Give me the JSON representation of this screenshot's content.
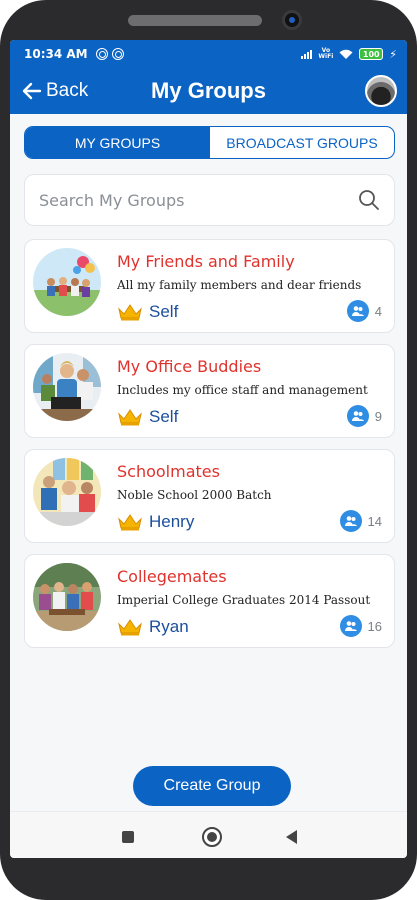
{
  "status_bar": {
    "time": "10:34 AM",
    "battery": "100",
    "network_label_top": "Vo",
    "network_label_bottom": "WiFi"
  },
  "app_bar": {
    "back_label": "Back",
    "title": "My Groups"
  },
  "tabs": [
    {
      "label": "MY GROUPS",
      "active": true
    },
    {
      "label": "BROADCAST GROUPS",
      "active": false
    }
  ],
  "search": {
    "placeholder": "Search My Groups",
    "value": ""
  },
  "groups": [
    {
      "name": "My Friends and Family",
      "description": "All my family members and dear friends",
      "owner": "Self",
      "members": "4"
    },
    {
      "name": "My Office Buddies",
      "description": "Includes my office staff and management",
      "owner": "Self",
      "members": "9"
    },
    {
      "name": "Schoolmates",
      "description": "Noble School 2000 Batch",
      "owner": "Henry",
      "members": "14"
    },
    {
      "name": "Collegemates",
      "description": "Imperial College Graduates 2014 Passout",
      "owner": "Ryan",
      "members": "16"
    }
  ],
  "actions": {
    "create_group_label": "Create Group"
  },
  "colors": {
    "primary": "#0b63c4",
    "group_name": "#e0322d",
    "owner_name": "#1b4f9c",
    "crown": "#f4b400",
    "members_badge": "#2f8de4"
  },
  "icons": {
    "back": "arrow-left-icon",
    "search": "search-icon",
    "owner": "crown-icon",
    "members": "group-members-icon"
  }
}
